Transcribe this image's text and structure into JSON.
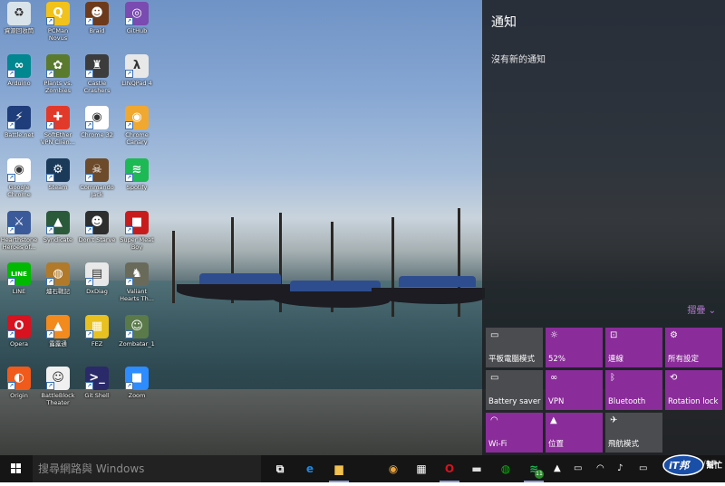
{
  "desktop_icons": [
    {
      "label": "資源回收筒",
      "color": "#d9e4ea",
      "glyph": "♻"
    },
    {
      "label": "PCMan\nNovus",
      "color": "#f1c21c",
      "glyph": "Q"
    },
    {
      "label": "Braid",
      "color": "#6d3b1c",
      "glyph": "☻"
    },
    {
      "label": "GitHub",
      "color": "#7a4bb0",
      "glyph": "◎"
    },
    {
      "label": "Arduino",
      "color": "#00878f",
      "glyph": "∞"
    },
    {
      "label": "Plants vs.\nZombies",
      "color": "#5a7a2e",
      "glyph": "✿"
    },
    {
      "label": "Castle\nCrashers",
      "color": "#3c3c3c",
      "glyph": "♜"
    },
    {
      "label": "LINQPad 4",
      "color": "#e8e8e8",
      "glyph": "λ"
    },
    {
      "label": "Battle.net",
      "color": "#1f3d7a",
      "glyph": "⚡"
    },
    {
      "label": "SoftEther\nVPN Clien...",
      "color": "#e23a2a",
      "glyph": "✚"
    },
    {
      "label": "Chrome 32",
      "color": "#ffffff",
      "glyph": "◉"
    },
    {
      "label": "Chrome\nCanary",
      "color": "#f0a830",
      "glyph": "◉"
    },
    {
      "label": "Google\nChrome",
      "color": "#ffffff",
      "glyph": "◉"
    },
    {
      "label": "Steam",
      "color": "#1b3a5a",
      "glyph": "⚙"
    },
    {
      "label": "Commando\nJack",
      "color": "#6c4a2a",
      "glyph": "☠"
    },
    {
      "label": "Spotify",
      "color": "#1db954",
      "glyph": "≋"
    },
    {
      "label": "Hearthstone\nHeroes of...",
      "color": "#3a5a9a",
      "glyph": "⚔"
    },
    {
      "label": "Syndicate",
      "color": "#2a5a3a",
      "glyph": "▲"
    },
    {
      "label": "Don't Starve",
      "color": "#2e2e2e",
      "glyph": "☻"
    },
    {
      "label": "Super Meat\nBoy",
      "color": "#c81c1c",
      "glyph": "■"
    },
    {
      "label": "LINE",
      "color": "#00b900",
      "glyph": "LINE"
    },
    {
      "label": "爐石戰記",
      "color": "#b07a2a",
      "glyph": "◍"
    },
    {
      "label": "DxDiag",
      "color": "#e8e8e8",
      "glyph": "▤"
    },
    {
      "label": "Valiant\nHearts Th...",
      "color": "#6a6a5a",
      "glyph": "♞"
    },
    {
      "label": "Opera",
      "color": "#d8121f",
      "glyph": "O"
    },
    {
      "label": "露露通",
      "color": "#f28a1e",
      "glyph": "▲"
    },
    {
      "label": "FEZ",
      "color": "#e8c020",
      "glyph": "▦"
    },
    {
      "label": "Zombatar_1",
      "color": "#5a7a4a",
      "glyph": "☺"
    },
    {
      "label": "Origin",
      "color": "#f05a1a",
      "glyph": "◐"
    },
    {
      "label": "BattleBlock\nTheater",
      "color": "#f0f0f0",
      "glyph": "☺"
    },
    {
      "label": "Git Shell",
      "color": "#2a2a6a",
      "glyph": ">_"
    },
    {
      "label": "Zoom",
      "color": "#2d8cff",
      "glyph": "■"
    }
  ],
  "action_center": {
    "title": "通知",
    "empty_text": "沒有新的通知",
    "collapse_label": "摺疊",
    "tiles": [
      {
        "label": "平板電腦模式",
        "icon": "tablet-icon",
        "glyph": "▭",
        "style": "gray"
      },
      {
        "label": "52%",
        "icon": "brightness-icon",
        "glyph": "☼",
        "style": "purple"
      },
      {
        "label": "連線",
        "icon": "connect-icon",
        "glyph": "⊡",
        "style": "purple"
      },
      {
        "label": "所有設定",
        "icon": "settings-icon",
        "glyph": "⚙",
        "style": "purple"
      },
      {
        "label": "Battery saver",
        "icon": "battery-icon",
        "glyph": "▭",
        "style": "gray"
      },
      {
        "label": "VPN",
        "icon": "vpn-icon",
        "glyph": "∞",
        "style": "purple"
      },
      {
        "label": "Bluetooth",
        "icon": "bluetooth-icon",
        "glyph": "ᛒ",
        "style": "purple"
      },
      {
        "label": "Rotation lock",
        "icon": "rotation-lock-icon",
        "glyph": "⟲",
        "style": "purple"
      },
      {
        "label": "Wi-Fi",
        "icon": "wifi-icon",
        "glyph": "◠",
        "style": "purple"
      },
      {
        "label": "位置",
        "icon": "location-icon",
        "glyph": "▲",
        "style": "purple"
      },
      {
        "label": "飛航模式",
        "icon": "airplane-icon",
        "glyph": "✈",
        "style": "gray"
      }
    ]
  },
  "taskbar": {
    "search_placeholder": "搜尋網路與 Windows",
    "apps": [
      {
        "name": "task-view",
        "glyph": "⧉",
        "color": "#ffffff",
        "active": false
      },
      {
        "name": "ie",
        "glyph": "e",
        "color": "#1e88e5",
        "active": false
      },
      {
        "name": "file-explorer",
        "glyph": "▆",
        "color": "#f2c14e",
        "active": true
      },
      {
        "name": "chrome",
        "glyph": "◉",
        "color": "#e8a33a",
        "active": false
      },
      {
        "name": "store",
        "glyph": "▦",
        "color": "#ffffff",
        "active": false
      },
      {
        "name": "opera",
        "glyph": "O",
        "color": "#d8121f",
        "active": true
      },
      {
        "name": "terminal",
        "glyph": "▬",
        "color": "#dddddd",
        "active": false
      },
      {
        "name": "line",
        "glyph": "◍",
        "color": "#00b900",
        "active": false
      },
      {
        "name": "spotify",
        "glyph": "≋",
        "color": "#1db954",
        "active": true
      }
    ],
    "spotify_badge": "11",
    "date": "2015/6/17"
  },
  "watermark": {
    "text": "iT邦",
    "subtext": "幫忙"
  }
}
